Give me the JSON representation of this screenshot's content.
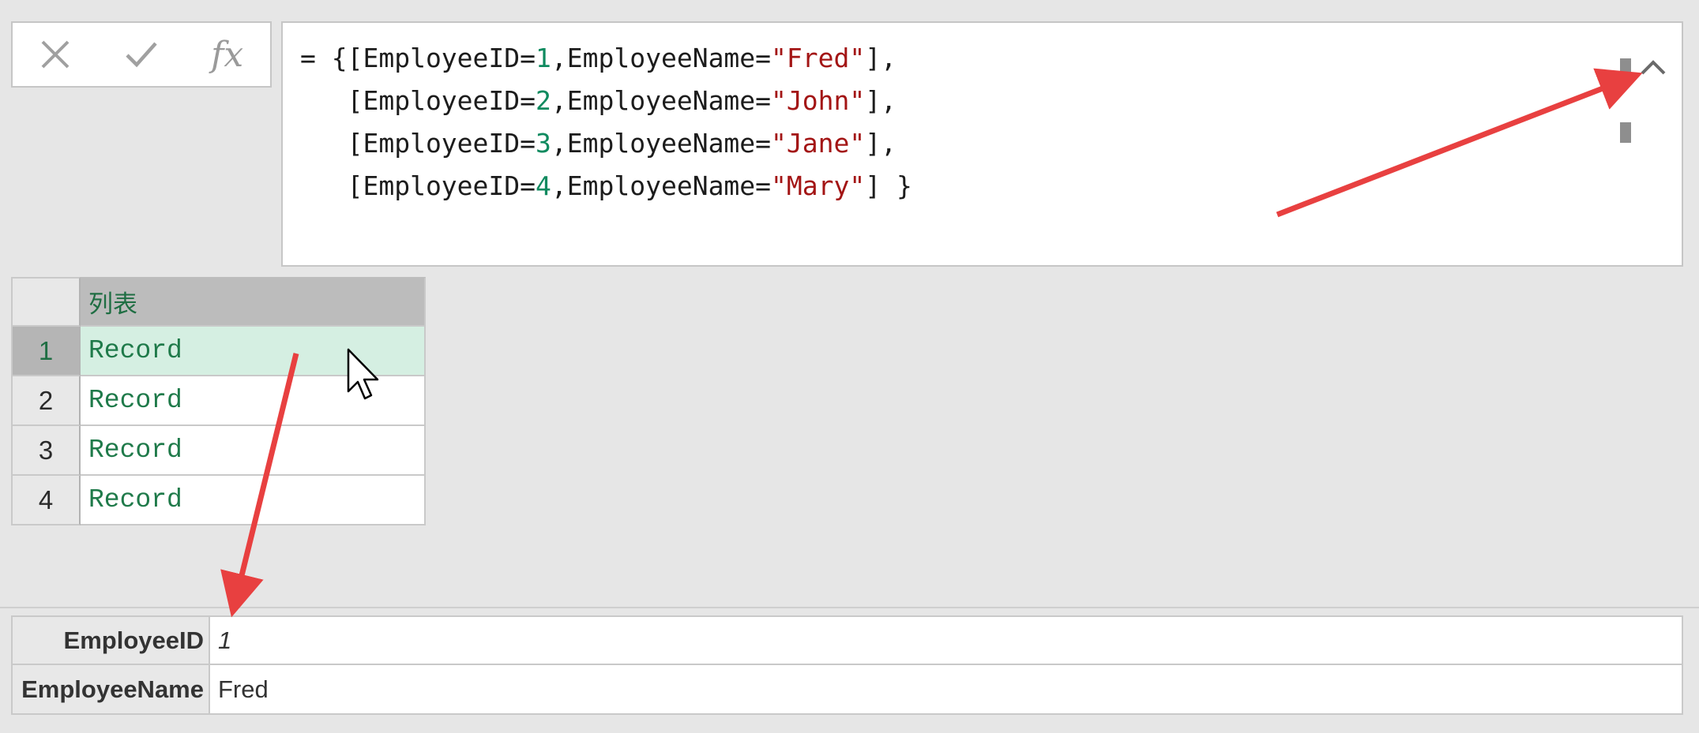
{
  "formula_bar": {
    "cancel_icon": "x-icon",
    "confirm_icon": "check-icon",
    "fx_label": "fx",
    "lines": [
      [
        {
          "t": "= {[EmployeeID="
        },
        {
          "t": "1",
          "k": "num"
        },
        {
          "t": ",EmployeeName="
        },
        {
          "t": "\"Fred\"",
          "k": "str"
        },
        {
          "t": "],"
        }
      ],
      [
        {
          "t": "   [EmployeeID="
        },
        {
          "t": "2",
          "k": "num"
        },
        {
          "t": ",EmployeeName="
        },
        {
          "t": "\"John\"",
          "k": "str"
        },
        {
          "t": "],"
        }
      ],
      [
        {
          "t": "   [EmployeeID="
        },
        {
          "t": "3",
          "k": "num"
        },
        {
          "t": ",EmployeeName="
        },
        {
          "t": "\"Jane\"",
          "k": "str"
        },
        {
          "t": "],"
        }
      ],
      [
        {
          "t": "   [EmployeeID="
        },
        {
          "t": "4",
          "k": "num"
        },
        {
          "t": ",EmployeeName="
        },
        {
          "t": "\"Mary\"",
          "k": "str"
        },
        {
          "t": "] }"
        }
      ]
    ],
    "collapse_icon": "chevron-up-icon"
  },
  "grid": {
    "column_header": "列表",
    "rows": [
      {
        "num": "1",
        "value": "Record"
      },
      {
        "num": "2",
        "value": "Record"
      },
      {
        "num": "3",
        "value": "Record"
      },
      {
        "num": "4",
        "value": "Record"
      }
    ],
    "selected_row": 1
  },
  "record_preview": {
    "fields": [
      {
        "key": "EmployeeID",
        "value": "1",
        "numeric": true
      },
      {
        "key": "EmployeeName",
        "value": "Fred",
        "numeric": false
      }
    ]
  },
  "colors": {
    "annotation_arrow": "#e84040",
    "selected_row": "#d5efe2",
    "number_token": "#0f8a5f",
    "string_token": "#a31515"
  }
}
